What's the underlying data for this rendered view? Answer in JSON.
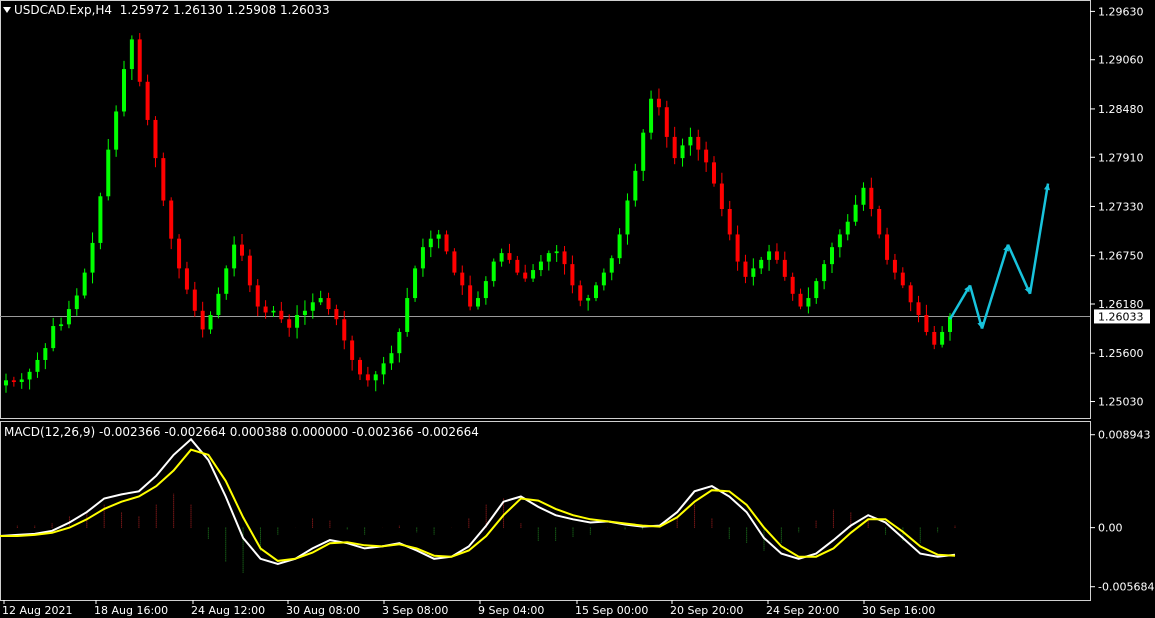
{
  "header": {
    "symbol": "USDCAD.Exp,H4",
    "ohlc": "1.25972 1.26130 1.25908 1.26033"
  },
  "macd_header": "MACD(12,26,9) -0.002366 -0.002664 0.000388 0.000000 -0.002366 -0.002664",
  "colors": {
    "bull": "#00ff00",
    "bear": "#ff0000",
    "macd_line": "#ffffff",
    "signal_line": "#ffff00",
    "hist_pos": "#b22222",
    "hist_neg": "#228b22",
    "forecast": "#18c3dc",
    "background": "#000000",
    "grid": "#ffffff"
  },
  "chart_data": [
    {
      "type": "candlestick",
      "title": "USDCAD.Exp,H4",
      "y_ticks": [
        "1.29630",
        "1.29060",
        "1.28480",
        "1.27910",
        "1.27330",
        "1.26750",
        "1.26180",
        "1.25600",
        "1.25030"
      ],
      "ylim": [
        1.2493,
        1.2967
      ],
      "current_price": "1.26033",
      "current_value": 1.26033,
      "x_ticks": [
        "12 Aug 2021",
        "18 Aug 16:00",
        "24 Aug 12:00",
        "30 Aug 08:00",
        "3 Sep 08:00",
        "9 Sep 04:00",
        "15 Sep 00:00",
        "20 Sep 20:00",
        "24 Sep 20:00",
        "30 Sep 16:00"
      ],
      "close_path": [
        1.2528,
        1.2526,
        1.2529,
        1.2538,
        1.2552,
        1.2566,
        1.2592,
        1.2594,
        1.2612,
        1.2628,
        1.2655,
        1.269,
        1.2745,
        1.28,
        1.2845,
        1.2895,
        1.293,
        1.288,
        1.2835,
        1.279,
        1.274,
        1.2695,
        1.266,
        1.2635,
        1.261,
        1.2588,
        1.2605,
        1.263,
        1.266,
        1.2688,
        1.2675,
        1.264,
        1.2615,
        1.2608,
        1.261,
        1.26,
        1.259,
        1.2605,
        1.261,
        1.262,
        1.2625,
        1.2612,
        1.26,
        1.2575,
        1.2552,
        1.2535,
        1.2528,
        1.2535,
        1.2548,
        1.256,
        1.2585,
        1.2625,
        1.266,
        1.2685,
        1.2695,
        1.27,
        1.268,
        1.2655,
        1.264,
        1.2615,
        1.2625,
        1.2645,
        1.2668,
        1.2678,
        1.267,
        1.2655,
        1.2648,
        1.2658,
        1.2668,
        1.2678,
        1.268,
        1.2665,
        1.264,
        1.2622,
        1.2625,
        1.264,
        1.2655,
        1.2672,
        1.27,
        1.274,
        1.2775,
        1.282,
        1.286,
        1.285,
        1.2815,
        1.279,
        1.2805,
        1.2815,
        1.28,
        1.2785,
        1.276,
        1.273,
        1.27,
        1.2668,
        1.265,
        1.266,
        1.267,
        1.268,
        1.267,
        1.265,
        1.263,
        1.2615,
        1.2625,
        1.2645,
        1.2665,
        1.2685,
        1.27,
        1.2715,
        1.2735,
        1.2755,
        1.273,
        1.27,
        1.267,
        1.2655,
        1.264,
        1.262,
        1.2605,
        1.2585,
        1.257,
        1.2585,
        1.2603
      ],
      "forecast_path": [
        [
          1.26,
          1.264
        ],
        [
          1.264,
          1.2589
        ],
        [
          1.2589,
          1.2688
        ],
        [
          1.2688,
          1.263
        ],
        [
          1.263,
          1.276
        ]
      ]
    },
    {
      "type": "line",
      "title": "MACD(12,26,9)",
      "y_ticks": [
        "0.008943",
        "0.00",
        "-0.005684"
      ],
      "ylim": [
        -0.006,
        0.0093
      ],
      "series": [
        {
          "name": "MACD",
          "values": [
            -0.0008,
            -0.0007,
            -0.0006,
            -0.0003,
            0.0005,
            0.0015,
            0.0028,
            0.0032,
            0.0035,
            0.005,
            0.007,
            0.0085,
            0.0065,
            0.003,
            -0.001,
            -0.003,
            -0.0035,
            -0.003,
            -0.002,
            -0.0012,
            -0.0015,
            -0.002,
            -0.0018,
            -0.0015,
            -0.0022,
            -0.003,
            -0.0028,
            -0.0018,
            0.0002,
            0.0025,
            0.003,
            0.002,
            0.0012,
            0.0008,
            0.0005,
            0.0006,
            0.0003,
            0.0001,
            0.0002,
            0.0015,
            0.0035,
            0.004,
            0.003,
            0.0015,
            -0.001,
            -0.0025,
            -0.003,
            -0.0025,
            -0.0012,
            0.0002,
            0.0012,
            0.0005,
            -0.001,
            -0.0025,
            -0.0028,
            -0.0026
          ]
        },
        {
          "name": "Signal",
          "values": [
            -0.0008,
            -0.0008,
            -0.0007,
            -0.0005,
            0.0,
            0.0008,
            0.0018,
            0.0025,
            0.003,
            0.004,
            0.0055,
            0.0075,
            0.007,
            0.0045,
            0.001,
            -0.002,
            -0.0032,
            -0.003,
            -0.0024,
            -0.0015,
            -0.0014,
            -0.0017,
            -0.0018,
            -0.0016,
            -0.002,
            -0.0027,
            -0.0028,
            -0.0022,
            -0.0008,
            0.0012,
            0.0028,
            0.0026,
            0.0018,
            0.0012,
            0.0008,
            0.0006,
            0.0004,
            0.0002,
            0.0001,
            0.001,
            0.0025,
            0.0036,
            0.0035,
            0.0022,
            0.0,
            -0.0018,
            -0.0028,
            -0.0028,
            -0.002,
            -0.0005,
            0.0008,
            0.0008,
            -0.0004,
            -0.0018,
            -0.0026,
            -0.0027
          ]
        }
      ]
    }
  ]
}
